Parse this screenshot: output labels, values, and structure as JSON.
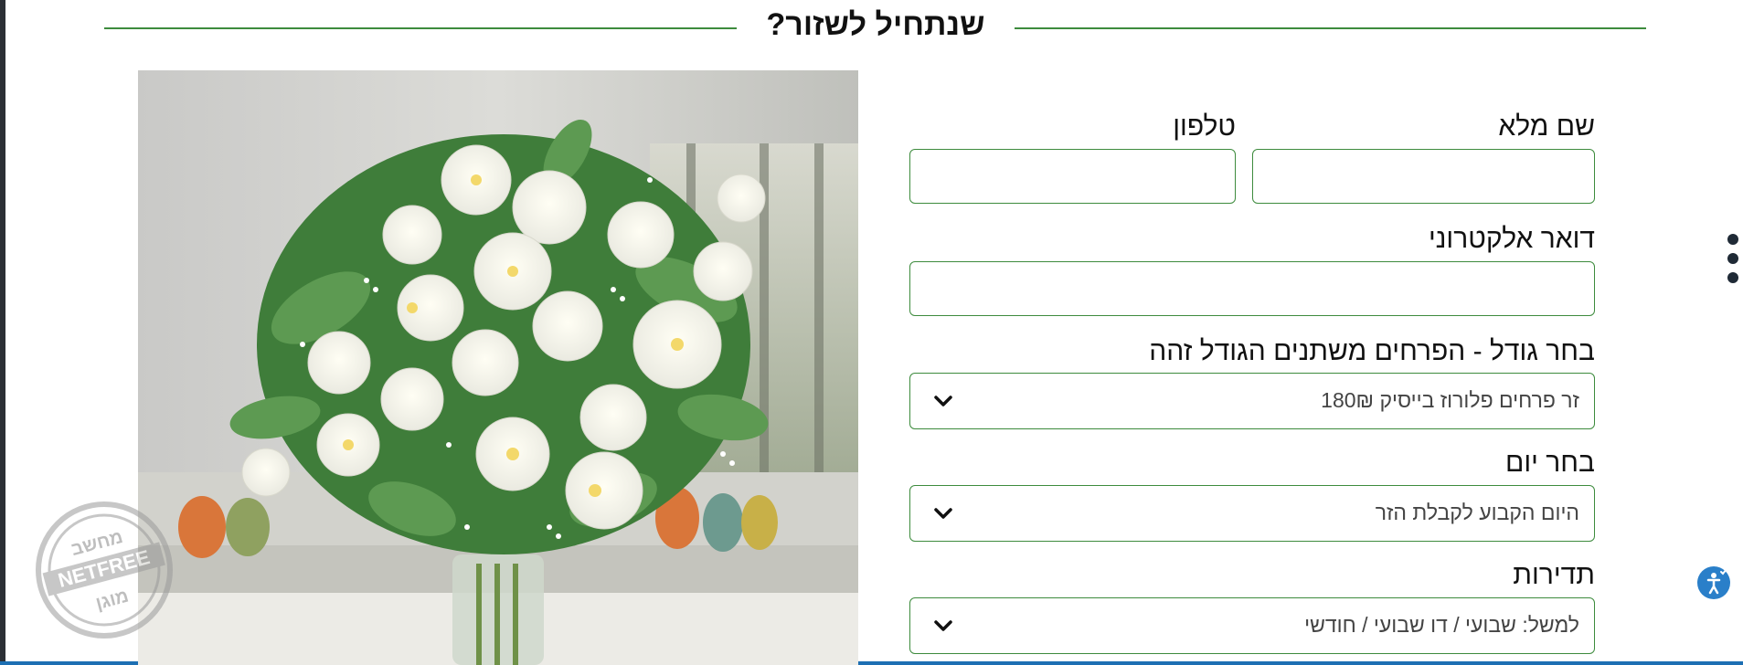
{
  "section": {
    "title": "שנתחיל לשזור?"
  },
  "form": {
    "full_name_label": "שם מלא",
    "phone_label": "טלפון",
    "email_label": "דואר אלקטרוני",
    "size_label": "בחר גודל - הפרחים משתנים הגודל זהה",
    "size_value": "זר פרחים פלורוז בייסיק 180₪",
    "day_label": "בחר יום",
    "day_value": "היום הקבוע לקבלת הזר",
    "frequency_label": "תדירות",
    "frequency_value": "למשל: שבועי / דו שבועי / חודשי"
  },
  "watermark": {
    "top_text": "מחשב",
    "brand": "NETFREE",
    "bottom_text": "מוגן"
  },
  "colors": {
    "accent_green": "#3d8b3d",
    "accessibility_blue": "#2a7fc9"
  },
  "icons": {
    "select_chevron": "chevron-down-icon",
    "menu": "kebab-menu-icon",
    "accessibility": "accessibility-icon"
  }
}
